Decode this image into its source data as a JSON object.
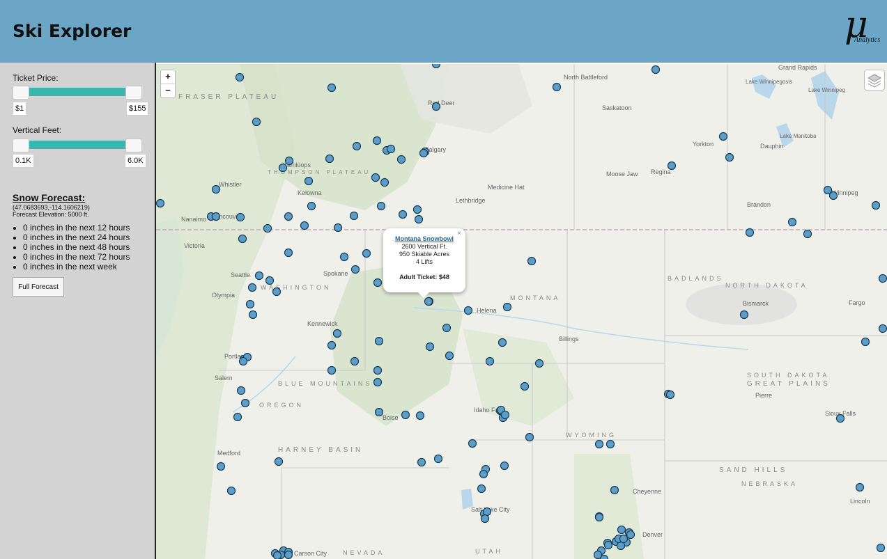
{
  "header": {
    "title": "Ski Explorer",
    "logo_symbol": "μ",
    "logo_text": "Analytics"
  },
  "sidebar": {
    "ticket_label": "Ticket Price:",
    "ticket_min": "$1",
    "ticket_max": "$155",
    "vertical_label": "Vertical Feet:",
    "vertical_min": "0.1K",
    "vertical_max": "6.0K",
    "forecast_title": "Snow Forecast:",
    "coords": "(47.0683693,-114.1606219)",
    "elevation": "Forecast Elevation: 5000 ft.",
    "forecast_items": [
      "0 inches in the next 12 hours",
      "0 inches in the next 24 hours",
      "0 inches in the next 48 hours",
      "0 inches in the next 72 hours",
      "0 inches in the next week"
    ],
    "full_forecast_button": "Full Forecast"
  },
  "map": {
    "zoom_in": "+",
    "zoom_out": "−",
    "layers_icon": "layers-icon",
    "popup": {
      "close": "×",
      "name": "Montana Snowbowl",
      "vertical": "2600 Vertical Ft.",
      "acres": "950 Skiable Acres",
      "lifts": "4 Lifts",
      "ticket": "Adult Ticket: $48"
    },
    "labels": [
      "North Battleford",
      "Saskatoon",
      "Red Deer",
      "Calgary",
      "Kamloops",
      "Kelowna",
      "Whistler",
      "Nanaimo",
      "Vancouver",
      "Victoria",
      "Medicine Hat",
      "Lethbridge",
      "Moose Jaw",
      "Regina",
      "Yorkton",
      "Dauphin",
      "Brandon",
      "Winnipeg",
      "Grand Rapids",
      "Seattle",
      "Olympia",
      "Spokane",
      "Kennewick",
      "Portland",
      "Salem",
      "Helena",
      "Billings",
      "Bismarck",
      "Fargo",
      "Pierre",
      "Sioux Falls",
      "Boise",
      "Idaho Falls",
      "Medford",
      "Cheyenne",
      "Denver",
      "Lincoln",
      "Carson City",
      "Salt Lake City",
      "MONTANA",
      "NORTH DAKOTA",
      "SOUTH DAKOTA",
      "WYOMING",
      "NEBRASKA",
      "OREGON",
      "WASHINGTON",
      "NEVADA",
      "UTAH",
      "BADLANDS",
      "GREAT PLAINS",
      "SAND HILLS",
      "HARNEY BASIN",
      "BLUE MOUNTAINS",
      "FRASER PLATEAU",
      "THOMPSON PLATEAU",
      "Lake Winnipegosis",
      "Lake Winnipeg",
      "Lake Manitoba"
    ],
    "marker_color": "#5b9ec9"
  }
}
